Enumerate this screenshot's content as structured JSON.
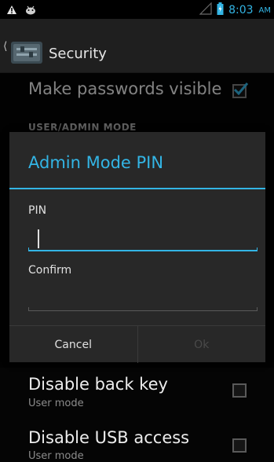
{
  "status_bar": {
    "time": "8:03",
    "ampm": "AM",
    "left_icons": [
      "warning-icon",
      "android-debug-icon"
    ],
    "right_icons": [
      "signal-icon",
      "battery-icon"
    ],
    "accent": "#33b5e5"
  },
  "action_bar": {
    "title": "Security"
  },
  "prefs": {
    "make_passwords_visible": {
      "title": "Make passwords visible",
      "checked": true
    },
    "section_header": "USER/ADMIN MODE",
    "disable_back_key": {
      "title": "Disable back key",
      "summary": "User mode",
      "checked": false
    },
    "disable_usb_access": {
      "title": "Disable USB access",
      "summary": "User mode",
      "checked": false
    }
  },
  "dialog": {
    "title": "Admin Mode PIN",
    "pin_label": "PIN",
    "pin_value": "",
    "confirm_label": "Confirm",
    "confirm_value": "",
    "cancel_label": "Cancel",
    "ok_label": "Ok",
    "ok_enabled": false
  }
}
